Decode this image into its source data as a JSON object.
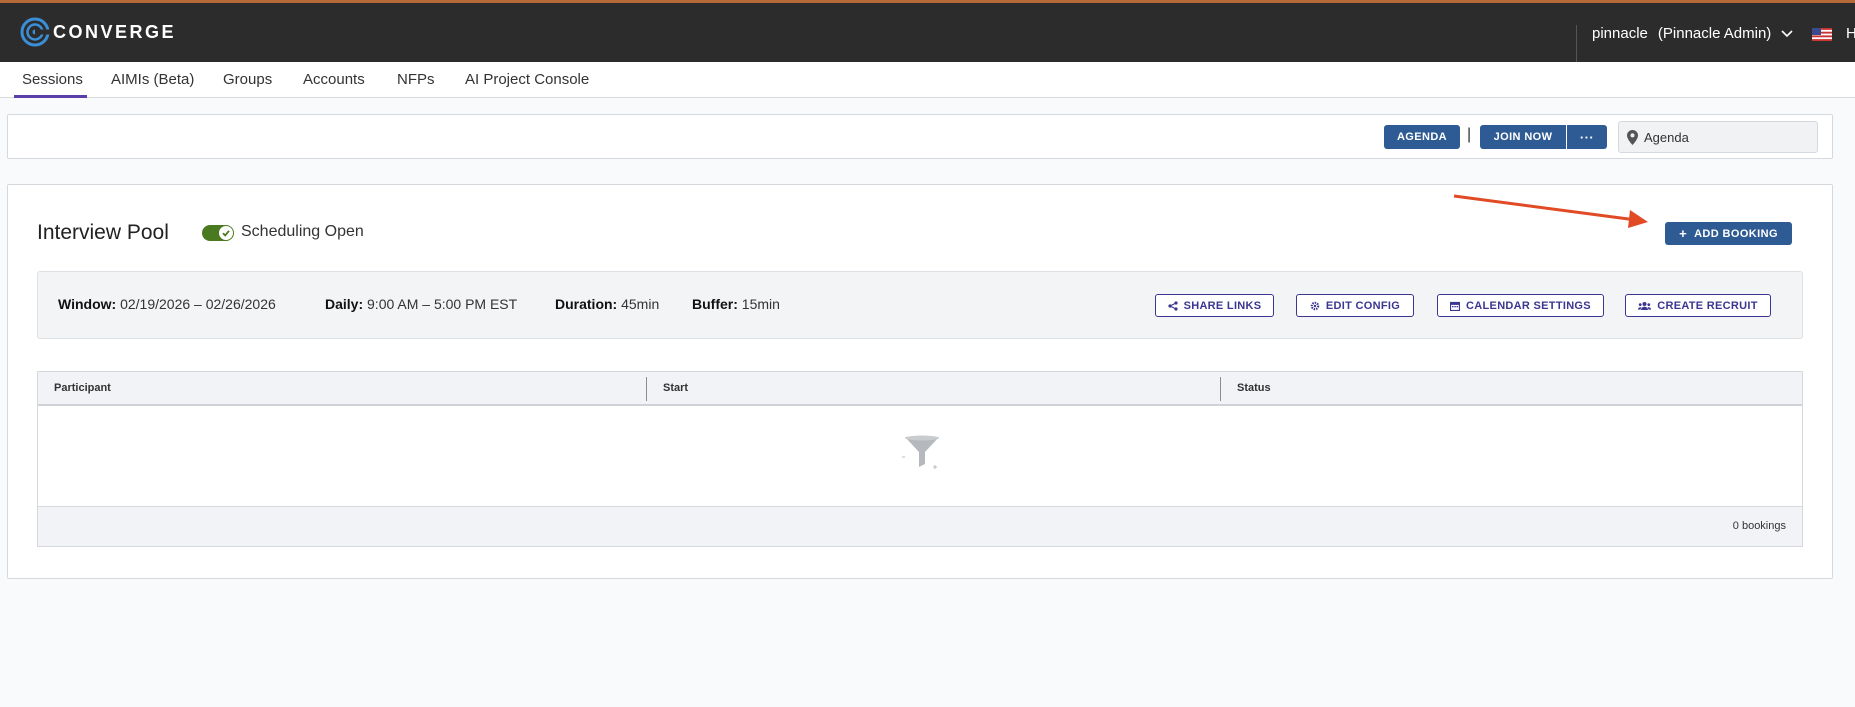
{
  "app": {
    "brand": "CONVERGE"
  },
  "user": {
    "name": "pinnacle",
    "role": "(Pinnacle Admin)",
    "trailing": "H"
  },
  "nav": {
    "items": [
      "Sessions",
      "AIMIs (Beta)",
      "Groups",
      "Accounts",
      "NFPs",
      "AI Project Console"
    ],
    "active": "Sessions"
  },
  "toolbar": {
    "agenda_label": "AGENDA",
    "join_label": "JOIN NOW",
    "more_label": "···",
    "separator": "|",
    "location_value": "Agenda"
  },
  "pool": {
    "title": "Interview Pool",
    "toggle_label": "Scheduling Open",
    "toggle_on": true,
    "add_booking_label": "ADD BOOKING",
    "add_booking_prefix": "+"
  },
  "config": {
    "window_label": "Window:",
    "window_value": "02/19/2026 – 02/26/2026",
    "daily_label": "Daily:",
    "daily_value": "9:00 AM – 5:00 PM EST",
    "duration_label": "Duration:",
    "duration_value": "45min",
    "buffer_label": "Buffer:",
    "buffer_value": "15min",
    "buttons": {
      "share": "SHARE LINKS",
      "edit": "EDIT CONFIG",
      "calendar": "CALENDAR SETTINGS",
      "recruit": "CREATE RECRUIT"
    }
  },
  "table": {
    "columns": [
      "Participant",
      "Start",
      "Status"
    ],
    "rows": [],
    "footer": "0 bookings"
  },
  "colors": {
    "topbar": "#2c2c2c",
    "primary": "#2f5b94",
    "accent_purple": "#5b3fa8",
    "toggle_green": "#4a7a1f",
    "annotation_arrow": "#e04a24"
  }
}
